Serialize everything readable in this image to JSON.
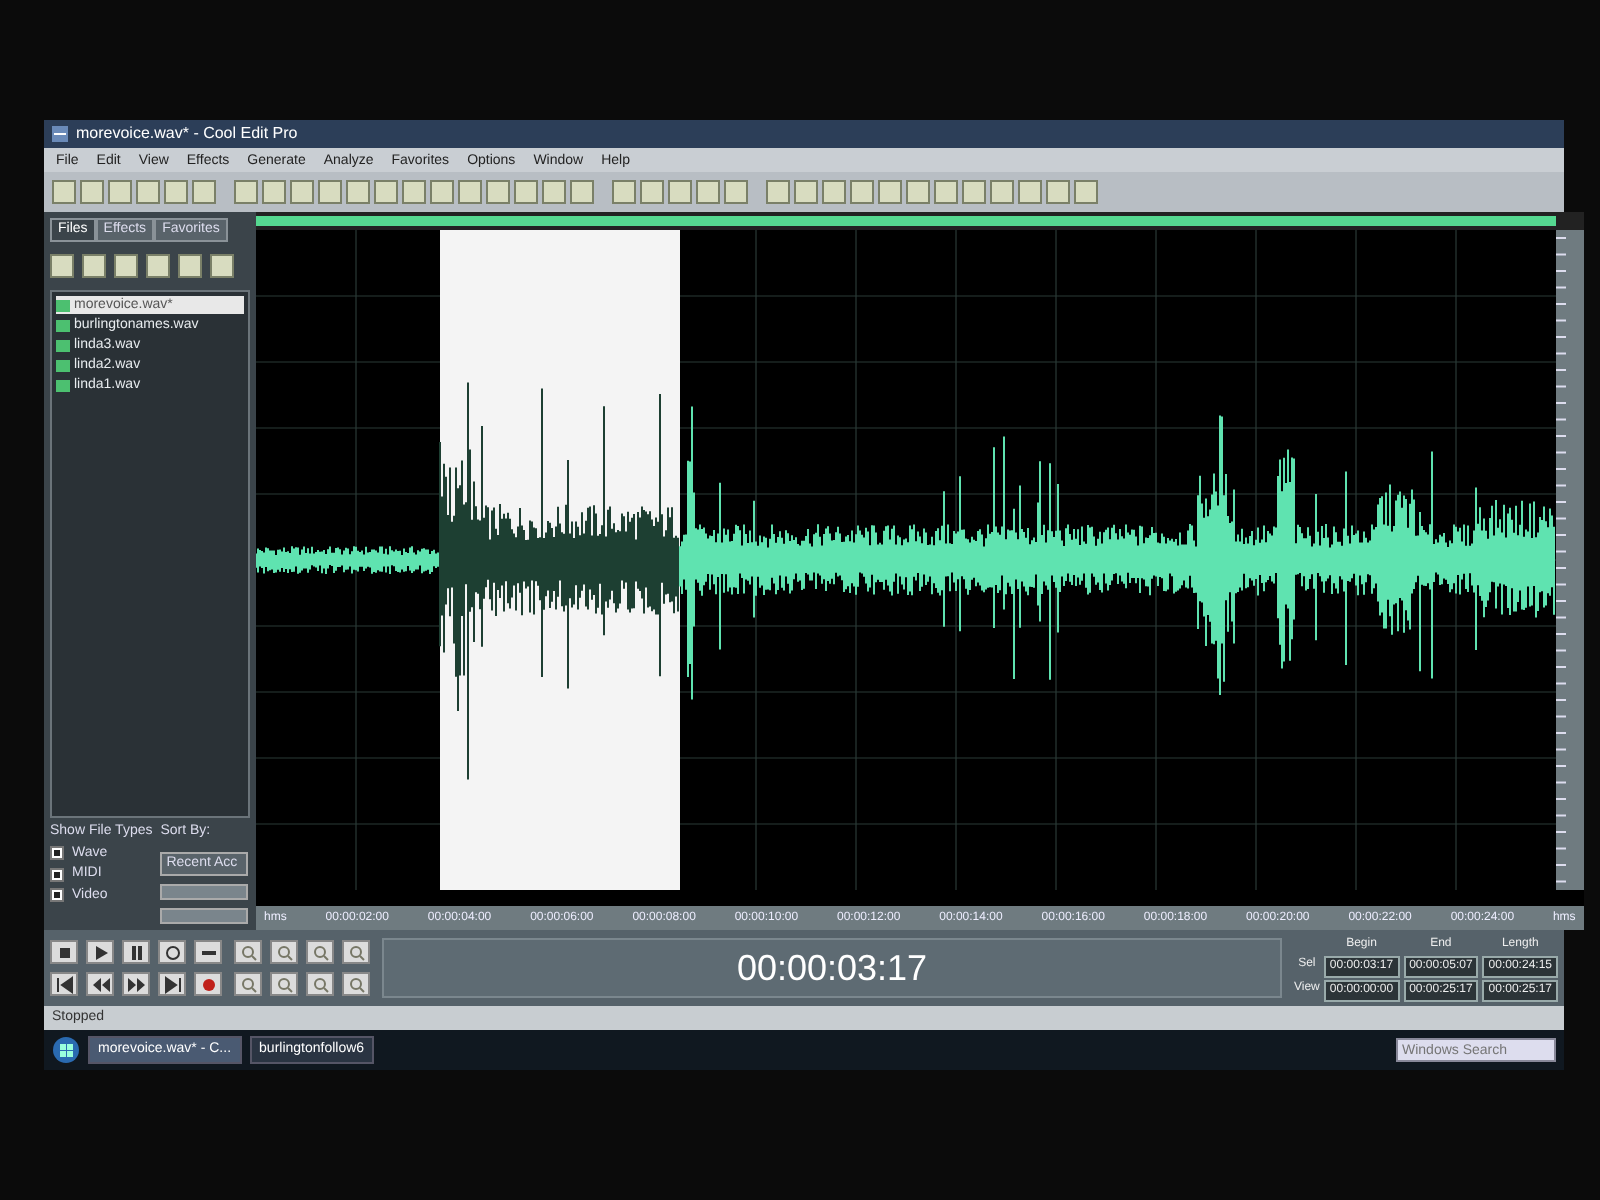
{
  "window": {
    "title": "morevoice.wav* - Cool Edit Pro"
  },
  "menu": [
    "File",
    "Edit",
    "View",
    "Effects",
    "Generate",
    "Analyze",
    "Favorites",
    "Options",
    "Window",
    "Help"
  ],
  "panel_tabs": [
    {
      "label": "Files",
      "selected": true
    },
    {
      "label": "Effects",
      "selected": false
    },
    {
      "label": "Favorites",
      "selected": false
    }
  ],
  "files": [
    {
      "name": "morevoice.wav*",
      "selected": true
    },
    {
      "name": "burlingtonames.wav",
      "selected": false
    },
    {
      "name": "linda3.wav",
      "selected": false
    },
    {
      "name": "linda2.wav",
      "selected": false
    },
    {
      "name": "linda1.wav",
      "selected": false
    }
  ],
  "show_file_types": {
    "label": "Show File Types",
    "types": [
      {
        "label": "Wave",
        "checked": true
      },
      {
        "label": "MIDI",
        "checked": true
      },
      {
        "label": "Video",
        "checked": true
      }
    ]
  },
  "sort_by": {
    "label": "Sort By:",
    "value": "Recent Acc"
  },
  "ruler": [
    "hms",
    "00:00:02:00",
    "00:00:04:00",
    "00:00:06:00",
    "00:00:08:00",
    "00:00:10:00",
    "00:00:12:00",
    "00:00:14:00",
    "00:00:16:00",
    "00:00:18:00",
    "00:00:20:00",
    "00:00:22:00",
    "00:00:24:00",
    "hms"
  ],
  "time_display": "00:00:03:17",
  "range": {
    "columns": [
      "Begin",
      "End",
      "Length"
    ],
    "rows": [
      {
        "label": "Sel",
        "values": [
          "00:00:03:17",
          "00:00:05:07",
          "00:00:24:15"
        ]
      },
      {
        "label": "View",
        "values": [
          "00:00:00:00",
          "00:00:25:17",
          "00:00:25:17"
        ]
      }
    ]
  },
  "status_bar": {
    "state": "Stopped"
  },
  "taskbar": {
    "items": [
      {
        "label": "morevoice.wav* - C...",
        "active": true
      },
      {
        "label": "burlingtonfollow6",
        "active": false
      }
    ],
    "search_placeholder": "Windows Search"
  }
}
